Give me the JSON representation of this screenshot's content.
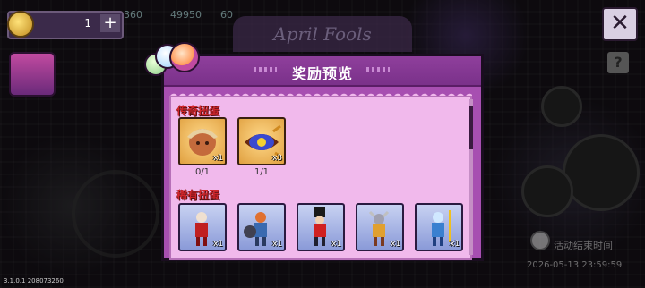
{
  "hud": {
    "coin_count": "1",
    "plus_label": "+",
    "stats": [
      "360",
      "49950",
      "60"
    ],
    "event_banner": "April Fools",
    "close_label": "✕",
    "help_label": "?",
    "event_time_label": "活动结束时间",
    "event_time_value": "2026-05-13 23:59:59",
    "version": "3.1.0.1 208073260"
  },
  "modal": {
    "title": "奖励预览",
    "sections": [
      {
        "title": "传奇扭蛋",
        "items": [
          {
            "name": "legendary-hero",
            "qty": "x1",
            "count": "0/1"
          },
          {
            "name": "legendary-eye-artifact",
            "qty": "x3",
            "count": "1/1"
          }
        ]
      },
      {
        "title": "稀有扭蛋",
        "items": [
          {
            "name": "rare-hero-1",
            "qty": "x1"
          },
          {
            "name": "rare-hero-2",
            "qty": "x1"
          },
          {
            "name": "rare-hero-3",
            "qty": "x1"
          },
          {
            "name": "rare-hero-4",
            "qty": "x1"
          },
          {
            "name": "rare-hero-5",
            "qty": "x1"
          }
        ]
      }
    ]
  },
  "colors": {
    "modal_bg": "#a74fb1",
    "content_bg": "#f1b9ec",
    "section_title": "#d1262b"
  }
}
